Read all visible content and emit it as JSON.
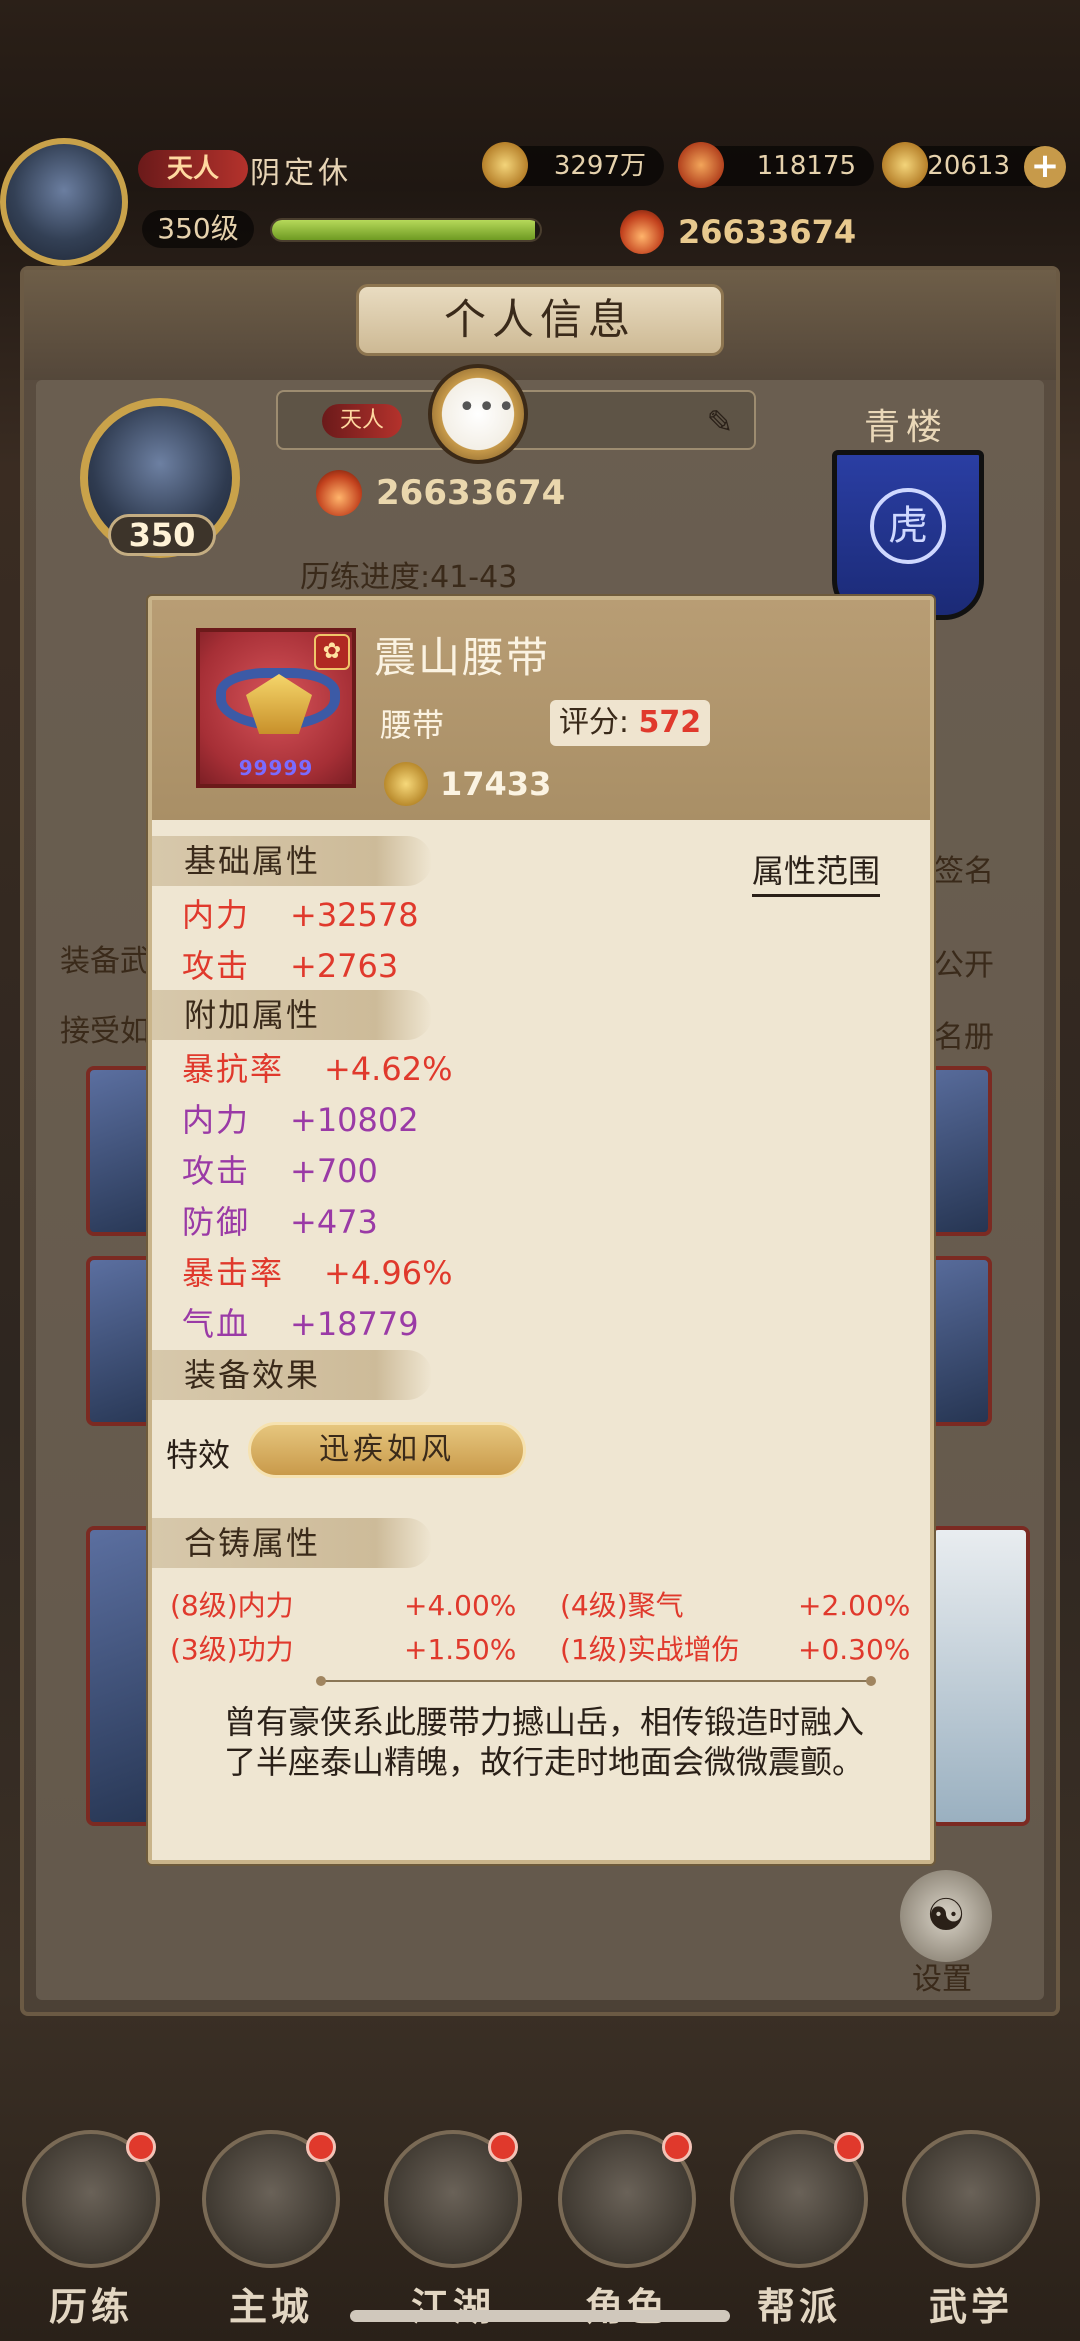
{
  "top": {
    "title_badge": "天人",
    "player_name": "阴定休",
    "resources": [
      {
        "name": "copper-coin",
        "value": "3297万"
      },
      {
        "name": "ingot",
        "value": "118175"
      },
      {
        "name": "gold",
        "value": "20613"
      }
    ],
    "level": "350级",
    "exp_fraction": 0.98,
    "power": "26633674"
  },
  "panel": {
    "title": "个人信息",
    "avatar_level": "350",
    "name_badge": "天人",
    "power": "26633674",
    "progress": "历练进度:41-43",
    "faction": "青楼",
    "side_texts": [
      "装备武",
      "接受如",
      "公开",
      "名册",
      "签名"
    ],
    "settings_label": "设置"
  },
  "item": {
    "name": "震山腰带",
    "type": "腰带",
    "score_label": "评分:",
    "score": "572",
    "stars": "99999",
    "price": "17433",
    "range_button": "属性范围",
    "base_header": "基础属性",
    "base_stats": [
      {
        "key": "内力",
        "value": "+32578"
      },
      {
        "key": "攻击",
        "value": "+2763"
      }
    ],
    "extra_header": "附加属性",
    "extra_stats": [
      {
        "key": "暴抗率",
        "value": "+4.62%",
        "color": "red"
      },
      {
        "key": "内力",
        "value": "+10802",
        "color": "purple"
      },
      {
        "key": "攻击",
        "value": "+700",
        "color": "purple"
      },
      {
        "key": "防御",
        "value": "+473",
        "color": "purple"
      },
      {
        "key": "暴击率",
        "value": "+4.96%",
        "color": "red"
      },
      {
        "key": "气血",
        "value": "+18779",
        "color": "purple"
      }
    ],
    "effect_header": "装备效果",
    "special_label": "特效",
    "special_value": "迅疾如风",
    "fuse_header": "合铸属性",
    "fuse_stats": [
      {
        "lv": "(8级)内力",
        "value": "+4.00%"
      },
      {
        "lv": "(4级)聚气",
        "value": "+2.00%"
      },
      {
        "lv": "(3级)功力",
        "value": "+1.50%"
      },
      {
        "lv": "(1级)实战增伤",
        "value": "+0.30%"
      }
    ],
    "description": "曾有豪侠系此腰带力撼山岳，相传锻造时融入了半座泰山精魄，故行走时地面会微微震颤。"
  },
  "nav": [
    {
      "label": "历练"
    },
    {
      "label": "主城"
    },
    {
      "label": "江湖"
    },
    {
      "label": "角色"
    },
    {
      "label": "帮派"
    },
    {
      "label": "武学"
    }
  ],
  "colors": {
    "accent_red": "#e0392c",
    "purple_stat": "#9a3aa6",
    "popup_bg": "#efe6d2"
  }
}
